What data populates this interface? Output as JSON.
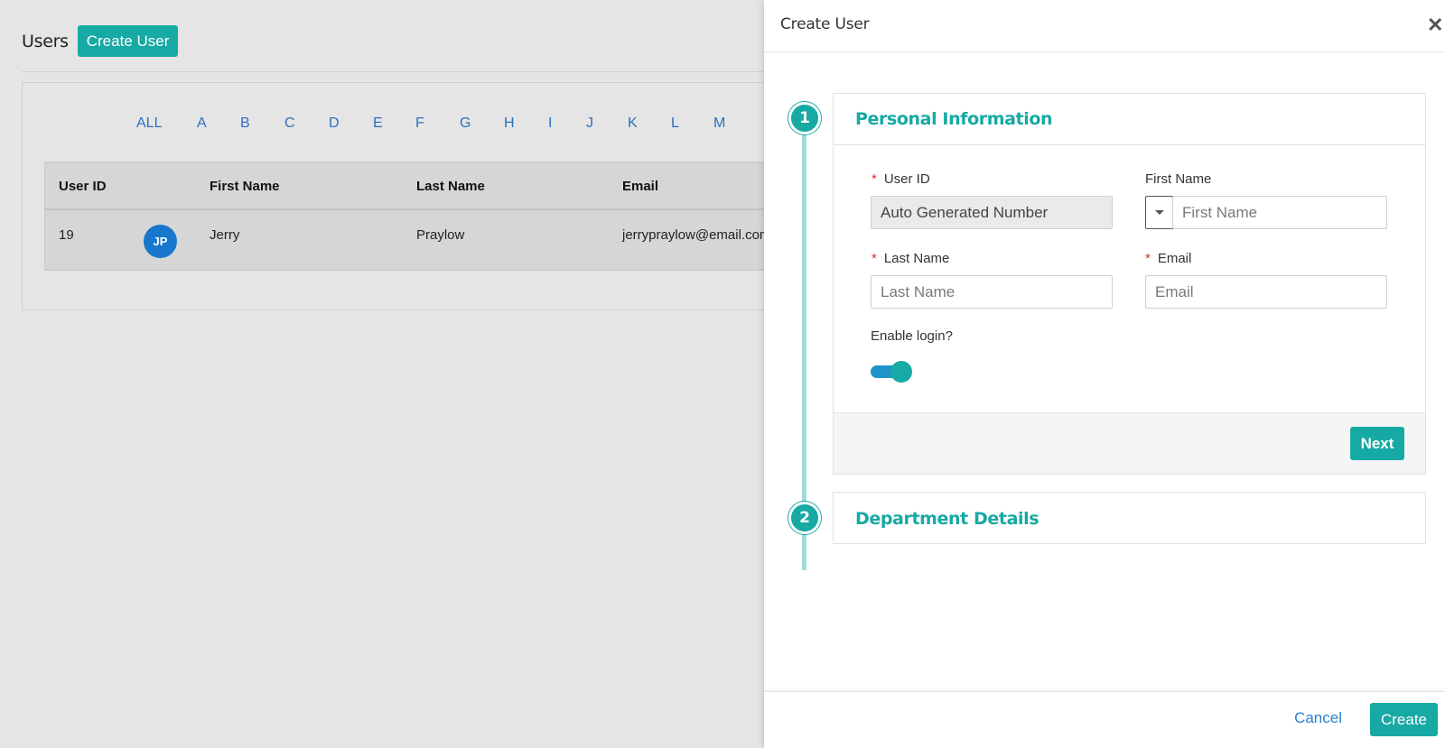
{
  "page": {
    "title": "Users",
    "create_button": "Create User",
    "alphabet": [
      "ALL",
      "A",
      "B",
      "C",
      "D",
      "E",
      "F",
      "G",
      "H",
      "I",
      "J",
      "K",
      "L",
      "M"
    ],
    "table": {
      "columns": [
        "User ID",
        "First Name",
        "Last Name",
        "Email"
      ],
      "rows": [
        {
          "user_id": "19",
          "avatar": "JP",
          "first_name": "Jerry",
          "last_name": "Praylow",
          "email": "jerrypraylow@email.com"
        }
      ]
    }
  },
  "drawer": {
    "title": "Create User",
    "close_icon": "close-icon",
    "steps": [
      {
        "number": "1",
        "title": "Personal Information"
      },
      {
        "number": "2",
        "title": "Department Details"
      }
    ],
    "form": {
      "required_mark": "*",
      "user_id": {
        "label": "User ID",
        "value": "Auto Generated Number"
      },
      "first_name": {
        "label": "First Name",
        "placeholder": "First Name"
      },
      "last_name": {
        "label": "Last Name",
        "placeholder": "Last Name"
      },
      "email": {
        "label": "Email",
        "placeholder": "Email"
      },
      "enable_login": {
        "label": "Enable login?",
        "enabled": true
      }
    },
    "next_button": "Next",
    "footer": {
      "cancel": "Cancel",
      "create": "Create"
    }
  },
  "colors": {
    "accent": "#17a9a3",
    "link": "#2c6fbf",
    "avatar": "#1677cc",
    "required": "#d9342b"
  }
}
